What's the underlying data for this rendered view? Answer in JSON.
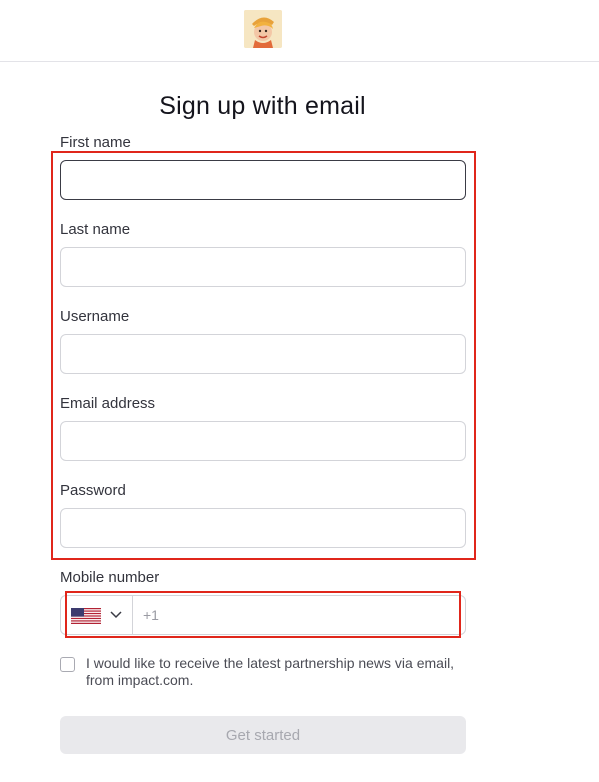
{
  "form": {
    "title": "Sign up with email",
    "fields": [
      {
        "label": "First name",
        "value": "",
        "placeholder": ""
      },
      {
        "label": "Last name",
        "value": "",
        "placeholder": ""
      },
      {
        "label": "Username",
        "value": "",
        "placeholder": ""
      },
      {
        "label": "Email address",
        "value": "",
        "placeholder": ""
      },
      {
        "label": "Password",
        "value": "",
        "placeholder": ""
      }
    ],
    "mobile": {
      "label": "Mobile number",
      "country_flag": "us-flag-icon",
      "placeholder": "+1",
      "value": ""
    },
    "consent": {
      "text": "I would like to receive the latest partnership news via email, from impact.com.",
      "checked": false
    },
    "submit_label": "Get started"
  },
  "colors": {
    "annotation": "#e0261b",
    "button_disabled_bg": "#e9e9ec",
    "button_disabled_text": "#a7a8af"
  }
}
